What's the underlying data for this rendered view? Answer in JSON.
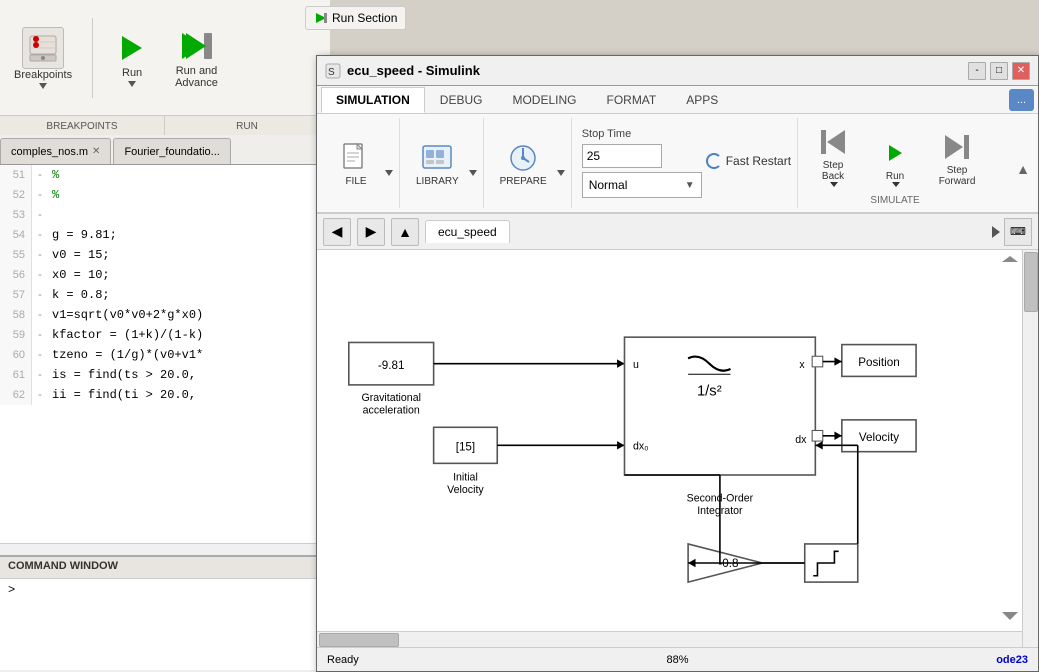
{
  "matlab": {
    "toolbar": {
      "breakpoints_label": "Breakpoints",
      "run_label": "Run",
      "run_advance_label": "Run and\nAdvance",
      "section_labels": [
        "BREAKPOINTS",
        "RUN"
      ],
      "run_section_btn": "Run Section"
    },
    "editor_tabs": [
      {
        "name": "comples_nos.m",
        "active": false
      },
      {
        "name": "Fourier_foundatio...",
        "active": false
      }
    ],
    "code_lines": [
      {
        "num": "51",
        "dash": "-",
        "code": "%",
        "type": "comment"
      },
      {
        "num": "52",
        "dash": "-",
        "code": "%",
        "type": "comment"
      },
      {
        "num": "53",
        "dash": "-",
        "code": "",
        "type": "plain"
      },
      {
        "num": "54",
        "dash": "-",
        "code": "g = 9.81;",
        "type": "plain"
      },
      {
        "num": "55",
        "dash": "-",
        "code": "v0 = 15;",
        "type": "plain"
      },
      {
        "num": "56",
        "dash": "-",
        "code": "x0 = 10;",
        "type": "plain"
      },
      {
        "num": "57",
        "dash": "-",
        "code": "k = 0.8;",
        "type": "plain"
      },
      {
        "num": "58",
        "dash": "-",
        "code": "v1=sqrt(v0*v0+2*g*x0)",
        "type": "plain"
      },
      {
        "num": "59",
        "dash": "-",
        "code": "kfactor = (1+k)/(1-k)",
        "type": "plain"
      },
      {
        "num": "60",
        "dash": "-",
        "code": "tzeno = (1/g)*(v0+v1*",
        "type": "plain"
      },
      {
        "num": "61",
        "dash": "-",
        "code": "is = find(ts > 20.0,",
        "type": "plain"
      },
      {
        "num": "62",
        "dash": "-",
        "code": "ii = find(ti > 20.0,",
        "type": "plain"
      }
    ],
    "command_window": {
      "title": "COMMAND WINDOW",
      "prompt": ">"
    }
  },
  "simulink": {
    "title": "ecu_speed - Simulink",
    "tabs": [
      "SIMULATION",
      "DEBUG",
      "MODELING",
      "FORMAT",
      "APPS"
    ],
    "active_tab": "SIMULATION",
    "more_btn": "...",
    "ribbon": {
      "stop_time_label": "Stop Time",
      "stop_time_value": "25",
      "mode_label": "Normal",
      "fast_restart_label": "Fast Restart",
      "buttons": {
        "step_back": "Step\nBack",
        "run": "Run",
        "step_forward": "Step\nForward"
      },
      "section_label": "SIMULATE"
    },
    "canvas": {
      "tab_name": "ecu_speed",
      "back_btn": "◀",
      "fwd_btn": "▶",
      "up_btn": "▲"
    },
    "diagram": {
      "blocks": [
        {
          "id": "grav",
          "label_above": "",
          "label_inside": "-9.81",
          "label_below": "Gravitational\nacceleration"
        },
        {
          "id": "init_vel",
          "label_inside": "[15]",
          "label_below": "Initial\nVelocity"
        },
        {
          "id": "integrator",
          "label_below": "Second-Order\nIntegrator",
          "ports": [
            "u",
            "dx₀",
            "x",
            "dx"
          ]
        },
        {
          "id": "position",
          "label": "Position"
        },
        {
          "id": "velocity",
          "label": "Velocity"
        },
        {
          "id": "gain",
          "label_inside": "-0.8"
        },
        {
          "id": "saturation",
          "label": ""
        }
      ]
    },
    "status": {
      "ready": "Ready",
      "zoom": "88%",
      "solver": "ode23"
    },
    "window_controls": [
      "-",
      "□",
      "✕"
    ]
  }
}
